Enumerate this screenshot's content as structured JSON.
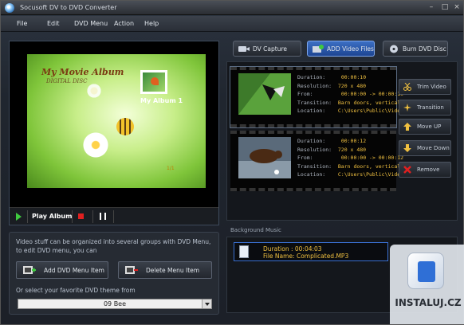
{
  "window": {
    "title": "Socusoft DV to DVD Converter"
  },
  "menu": [
    "File",
    "Edit",
    "DVD Menu",
    "Action",
    "Help"
  ],
  "preview": {
    "album_title": "My Movie Album",
    "album_subtitle": "DIGITAL DISC",
    "album_button": "My Album 1",
    "album_page": "1/1",
    "play_label": "Play Album"
  },
  "info": {
    "text": "Video stuff can be organized into several groups with DVD Menu, to edit DVD menu, you can",
    "add_menu_item": "Add DVD Menu Item",
    "delete_menu_item": "Delete Menu Item",
    "theme_label": "Or select your favorite DVD theme from",
    "theme_selected": "09 Bee"
  },
  "tabs": [
    {
      "label": "DV Capture",
      "active": false
    },
    {
      "label": "ADD Video Files",
      "active": true
    },
    {
      "label": "Burn DVD Disc",
      "active": false
    }
  ],
  "files": [
    {
      "duration_label": "Duration:",
      "duration": "00:00:10",
      "resolution_label": "Resolution:",
      "resolution": "720 x 480",
      "from_label": "From:",
      "from": "00:00:00 -> 00:00:10",
      "transition_label": "Transition:",
      "transition": "Barn doors, vertical",
      "location_label": "Location:",
      "location": "C:\\Users\\Public\\Videos"
    },
    {
      "duration_label": "Duration:",
      "duration": "00:00:12",
      "resolution_label": "Resolution:",
      "resolution": "720 x 480",
      "from_label": "From:",
      "from": "00:00:00 -> 00:00:12",
      "transition_label": "Transition:",
      "transition": "Barn doors, vertical",
      "location_label": "Location:",
      "location": "C:\\Users\\Public\\Videos"
    }
  ],
  "side_buttons": [
    "Trim Video",
    "Transition",
    "Move UP",
    "Move Down",
    "Remove"
  ],
  "music": {
    "section_label": "Background Music",
    "duration": "Duration : 00:04:03",
    "file_name": "File Name: Complicated.MP3"
  },
  "watermark": "INSTALUJ.CZ",
  "colors": {
    "accent": "#1d4592",
    "highlight_text": "#f0c040",
    "play": "#3fc93f",
    "stop": "#e02020"
  }
}
